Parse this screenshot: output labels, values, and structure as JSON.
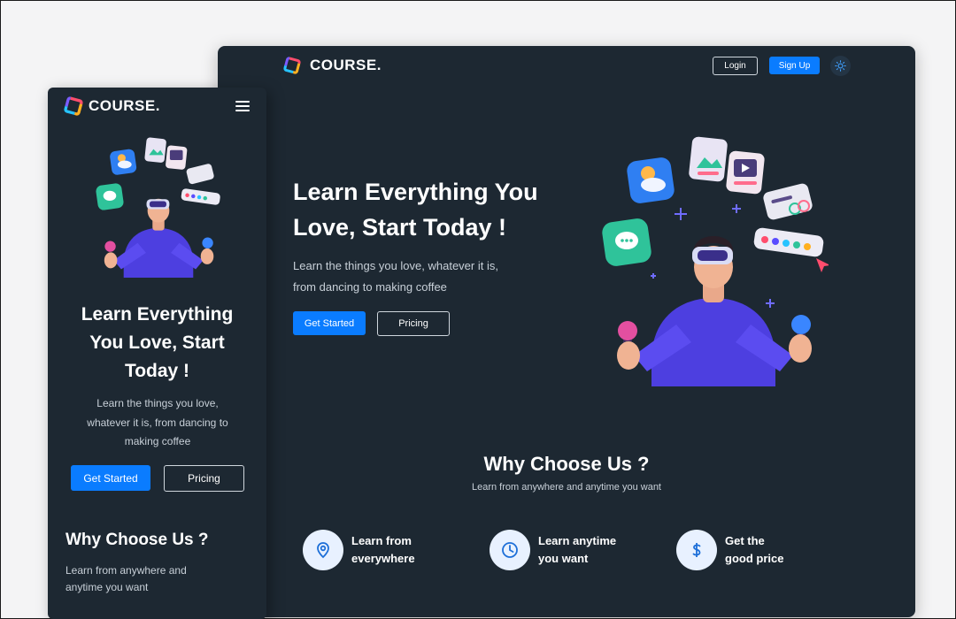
{
  "brand": {
    "name": "COURSE."
  },
  "desktop": {
    "nav": {
      "login_label": "Login",
      "signup_label": "Sign Up",
      "theme_icon": "sun-icon"
    },
    "hero": {
      "title_line1": "Learn Everything You",
      "title_line2": "Love, Start Today !",
      "subtitle_line1": "Learn the things you love, whatever it is,",
      "subtitle_line2": "from dancing to making coffee",
      "primary_label": "Get Started",
      "secondary_label": "Pricing"
    },
    "why": {
      "title": "Why Choose Us ?",
      "subtitle": "Learn from anywhere and anytime you want",
      "features": [
        {
          "icon": "location-pin-icon",
          "line1": "Learn from",
          "line2": "everywhere"
        },
        {
          "icon": "clock-icon",
          "line1": "Learn anytime",
          "line2": "you want"
        },
        {
          "icon": "dollar-icon",
          "line1": "Get the",
          "line2": "good price"
        }
      ]
    }
  },
  "mobile": {
    "menu_icon": "hamburger-menu-icon",
    "hero": {
      "title_line1": "Learn Everything",
      "title_line2": "You Love, Start",
      "title_line3": "Today !",
      "subtitle_line1": "Learn the things you love,",
      "subtitle_line2": "whatever it is, from dancing to",
      "subtitle_line3": "making coffee",
      "primary_label": "Get Started",
      "secondary_label": "Pricing"
    },
    "why": {
      "title": "Why Choose Us ?",
      "subtitle_line1": "Learn from anywhere and",
      "subtitle_line2": "anytime you want"
    }
  },
  "colors": {
    "background": "#1d2832",
    "accent": "#0a7cff",
    "figure": "#4d3fe0"
  }
}
